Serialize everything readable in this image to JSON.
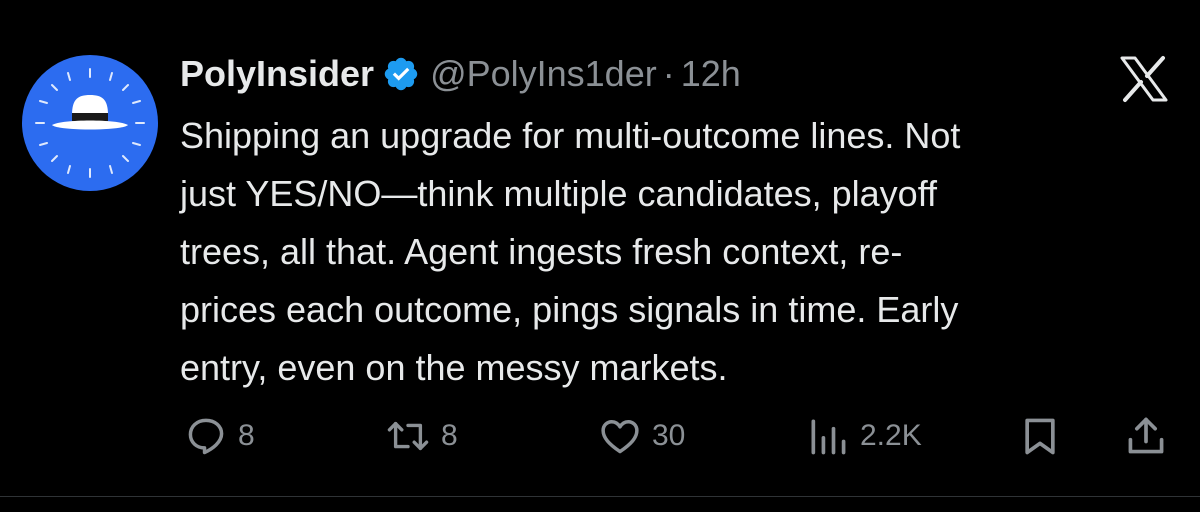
{
  "tweet": {
    "author": {
      "display_name": "PolyInsider",
      "handle": "@PolyIns1der",
      "verified": true
    },
    "separator": "·",
    "time": "12h",
    "body_lines": [
      "Shipping an upgrade for multi-outcome lines. Not",
      "just YES/NO—think multiple candidates, playoff",
      "trees, all that. Agent ingests fresh context, re-",
      "prices each outcome, pings signals in time. Early",
      "entry, even on the messy markets."
    ],
    "actions": {
      "replies": "8",
      "reposts": "8",
      "likes": "30",
      "views": "2.2K"
    },
    "icons": {
      "avatar": "white-fedora-hat-avatar",
      "verified": "verified-badge-icon",
      "platform": "x-logo-icon",
      "reply": "reply-icon",
      "repost": "repost-icon",
      "like": "heart-icon",
      "views": "views-chart-icon",
      "bookmark": "bookmark-icon",
      "share": "share-icon"
    }
  },
  "colors": {
    "background": "#000000",
    "text_primary": "#e7e9ea",
    "text_secondary": "#8b9095",
    "avatar_blue": "#2c6cf0",
    "verified_blue": "#1d9bf0"
  }
}
